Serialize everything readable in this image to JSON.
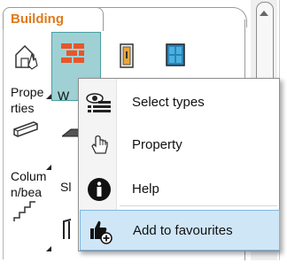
{
  "panel": {
    "tab_label": "Building",
    "tiles": [
      {
        "label": "Prope\nrties",
        "icon": "properties-icon"
      },
      {
        "label": "W",
        "icon": "wall-icon"
      },
      {
        "label": "",
        "icon": "door-icon"
      },
      {
        "label": "",
        "icon": "window-icon"
      },
      {
        "label": "Colum\nn/bea",
        "icon": "column-icon"
      },
      {
        "label": "Sl",
        "icon": "slab-icon"
      },
      {
        "label": "",
        "icon": "stair-icon"
      },
      {
        "label": "",
        "icon": "railing-icon"
      }
    ]
  },
  "context_menu": {
    "items": [
      {
        "label": "Select types",
        "icon": "select-types-icon"
      },
      {
        "label": "Property",
        "icon": "hand-pointer-icon"
      },
      {
        "label": "Help",
        "icon": "info-icon"
      },
      {
        "label": "Add to favourites",
        "icon": "add-favourite-icon"
      }
    ]
  },
  "colors": {
    "tab_label": "#e07a19",
    "selected_tile": "#9fd1d4",
    "menu_highlight": "#cfe6f7"
  }
}
